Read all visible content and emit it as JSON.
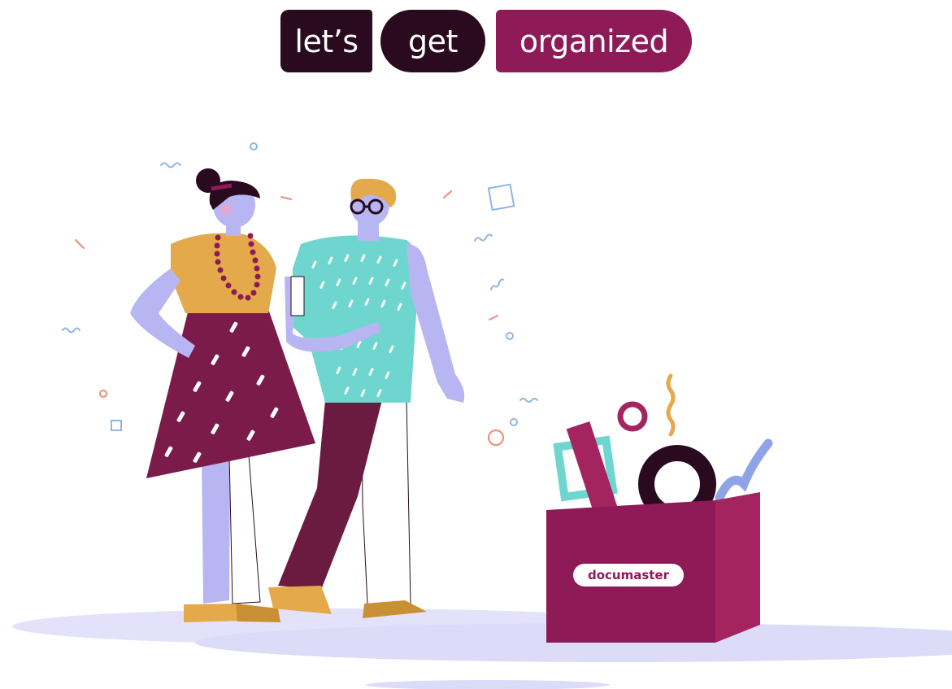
{
  "headline": {
    "word1": "let’s",
    "word2": "get",
    "word3": "organized"
  },
  "box": {
    "label": "documaster"
  },
  "colors": {
    "dark_plum": "#2a0a1e",
    "magenta": "#8e1a57",
    "mustard": "#e3a94a",
    "lavender": "#b7b6f2",
    "teal": "#6fd6cf",
    "coral": "#f08a78",
    "blue_outline": "#8fb5e8"
  },
  "illustration": {
    "figures": [
      "woman",
      "man",
      "storage-box"
    ]
  }
}
